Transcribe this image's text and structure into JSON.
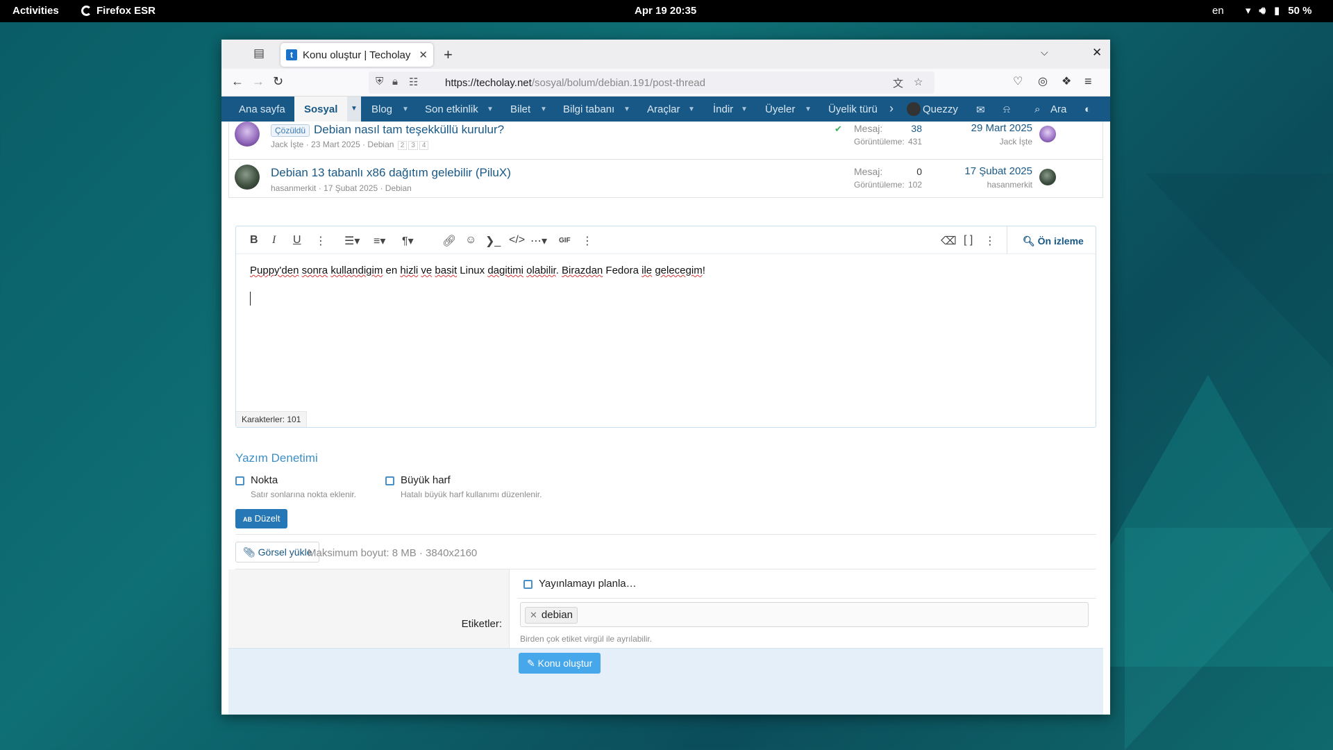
{
  "system": {
    "activities": "Activities",
    "app_name": "Firefox ESR",
    "clock": "Apr 19  20:35",
    "lang": "en",
    "battery": "50 %"
  },
  "browser": {
    "tab_title": "Konu oluştur | Techolay S",
    "url_domain": "https://techolay.net",
    "url_path": "/sosyal/bolum/debian.191/post-thread"
  },
  "sitenav": {
    "items": [
      "Ana sayfa",
      "Sosyal",
      "Blog",
      "Son etkinlik",
      "Bilet",
      "Bilgi tabanı",
      "Araçlar",
      "İndir",
      "Üyeler",
      "Üyelik türü"
    ],
    "user": "Quezzy",
    "search": "Ara"
  },
  "threads": [
    {
      "prefix": "Çözüldü",
      "title": "Debian nasıl tam teşekküllü kurulur?",
      "author": "Jack İşte",
      "date": "23 Mart 2025",
      "forum": "Debian",
      "pages": [
        "2",
        "3",
        "4"
      ],
      "replies_label": "Mesaj:",
      "replies": "38",
      "views_label": "Görüntüleme:",
      "views": "431",
      "last_date": "29 Mart 2025",
      "last_user": "Jack İşte"
    },
    {
      "prefix": "",
      "title": "Debian 13 tabanlı x86 dağıtım gelebilir (PiluX)",
      "author": "hasanmerkit",
      "date": "17 Şubat 2025",
      "forum": "Debian",
      "pages": [],
      "replies_label": "Mesaj:",
      "replies": "0",
      "views_label": "Görüntüleme:",
      "views": "102",
      "last_date": "17 Şubat 2025",
      "last_user": "hasanmerkit"
    }
  ],
  "editor": {
    "preview": "Ön izleme",
    "text_parts": [
      "Puppy'den",
      " ",
      "sonra",
      " ",
      "kullandigim",
      " en ",
      "hizli",
      " ",
      "ve",
      " ",
      "basit",
      " Linux ",
      "dagitimi",
      " ",
      "olabilir",
      ". ",
      "Birazdan",
      " Fedora ",
      "ile",
      " ",
      "gelecegim",
      "!"
    ],
    "char_count": "Karakterler: 101"
  },
  "spell": {
    "heading": "Yazım Denetimi",
    "opt1_label": "Nokta",
    "opt1_hint": "Satır sonlarına nokta eklenir.",
    "opt2_label": "Büyük harf",
    "opt2_hint": "Hatalı büyük harf kullanımı düzenlenir.",
    "fix_button": "Düzelt"
  },
  "upload": {
    "button": "Görsel yükle",
    "info": "Maksimum boyut: 8 MB · 3840x2160"
  },
  "form": {
    "schedule": "Yayınlamayı planla…",
    "tags_label": "Etiketler:",
    "tag": "debian",
    "tags_hint": "Birden çok etiket virgül ile ayrılabilir.",
    "submit": "Konu oluştur"
  }
}
